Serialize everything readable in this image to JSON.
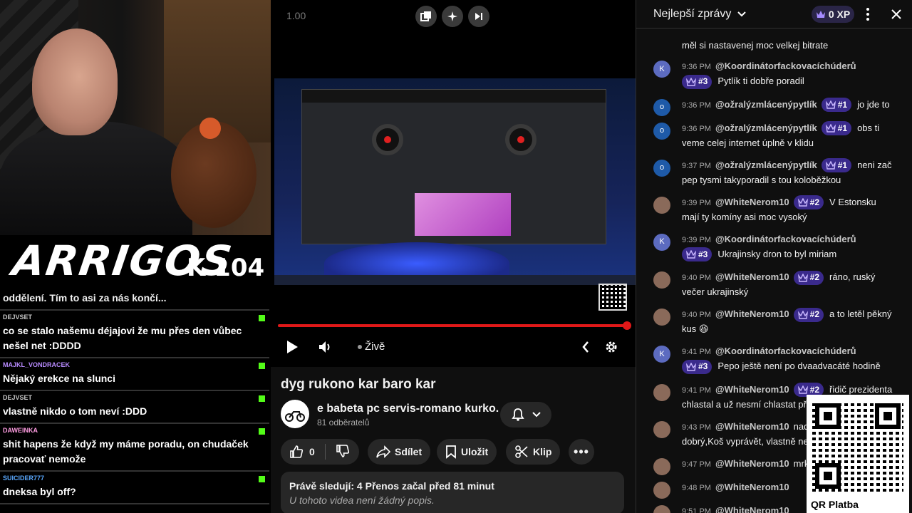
{
  "stream": {
    "logo_main": "ARRIGOS",
    "logo_sub": "K 104",
    "first_line": "oddělení. Tím to asi za nás končí...",
    "messages": [
      {
        "user": "DEJVSET",
        "text": "co se stalo našemu déjajovi že mu přes den vůbec nešel net :DDDD",
        "color": "#c7c7c7"
      },
      {
        "user": "MAJKL_VONDRACEK",
        "text": "Nějaký erekce na slunci",
        "color": "#b88bff"
      },
      {
        "user": "DEJVSET",
        "text": "vlastně nikdo o tom neví :DDD",
        "color": "#c7c7c7"
      },
      {
        "user": "DAWEINKA",
        "text": "shit hapens že když my máme poradu, on chudaček pracovať nemože",
        "color": "#ff9de2"
      },
      {
        "user": "SUICIDER777",
        "text": "dneksa byl off?",
        "color": "#5aa9ff"
      }
    ]
  },
  "player": {
    "speed": "1.00",
    "live_label": "Živě",
    "progress": 1.0
  },
  "video": {
    "title": "dyg rukono kar baro kar",
    "channel_name": "e babeta pc servis-romano kurko.",
    "subscribers": "81 odběratelů",
    "likes": "0",
    "share_label": "Sdílet",
    "save_label": "Uložit",
    "clip_label": "Klip",
    "stats": "Právě sledují: 4  Přenos začal před 81 minut",
    "description": "U tohoto videa není žádný popis."
  },
  "chat": {
    "title": "Nejlepší zprávy",
    "xp": "0 XP",
    "partial_text": "měl si nastavenej moc velkej bitrate",
    "messages": [
      {
        "time": "9:36 PM",
        "author": "@Koordinátorfackovacíchúderů",
        "rank": "#3",
        "text": "Pytlík ti dobře poradil",
        "avatar": "K",
        "avatar_color": "#5c6bc0"
      },
      {
        "time": "9:36 PM",
        "author": "@ožralýzmlácenýpytlík",
        "rank": "#1",
        "text": "jo jde to",
        "avatar": "o",
        "avatar_color": "#1e5aa8"
      },
      {
        "time": "9:36 PM",
        "author": "@ožralýzmlácenýpytlík",
        "rank": "#1",
        "text": "obs ti veme celej internet úplně v klidu",
        "avatar": "o",
        "avatar_color": "#1e5aa8"
      },
      {
        "time": "9:37 PM",
        "author": "@ožralýzmlácenýpytlík",
        "rank": "#1",
        "text": "neni zač pep tysmi takyporadil s tou koloběžkou",
        "avatar": "o",
        "avatar_color": "#1e5aa8"
      },
      {
        "time": "9:39 PM",
        "author": "@WhiteNerom10",
        "rank": "#2",
        "text": "V Estonsku mají ty komíny asi moc vysoký",
        "avatar": "",
        "avatar_color": "#8a6a5a"
      },
      {
        "time": "9:39 PM",
        "author": "@Koordinátorfackovacíchúderů",
        "rank": "#3",
        "text": "Ukrajinsky dron to byl miriam",
        "avatar": "K",
        "avatar_color": "#5c6bc0"
      },
      {
        "time": "9:40 PM",
        "author": "@WhiteNerom10",
        "rank": "#2",
        "text": "ráno, ruský večer ukrajinský",
        "avatar": "",
        "avatar_color": "#8a6a5a"
      },
      {
        "time": "9:40 PM",
        "author": "@WhiteNerom10",
        "rank": "#2",
        "text": "a to letěl pěkný kus 😆",
        "avatar": "",
        "avatar_color": "#8a6a5a"
      },
      {
        "time": "9:41 PM",
        "author": "@Koordinátorfackovacíchúderů",
        "rank": "#3",
        "text": "Pepo ještě není po dvaadvacáté hodině",
        "avatar": "K",
        "avatar_color": "#5c6bc0"
      },
      {
        "time": "9:41 PM",
        "author": "@WhiteNerom10",
        "rank": "#2",
        "text": "řidič prezidenta chlastal a už nesmí chlastat při hotovosti",
        "avatar": "",
        "avatar_color": "#8a6a5a"
      },
      {
        "time": "9:43 PM",
        "author": "@WhiteNerom10",
        "rank": "",
        "text": "nad Moskvou nejsou dobrý,Koš vyprávět, vlastně nemohl už",
        "avatar": "",
        "avatar_color": "#8a6a5a"
      },
      {
        "time": "9:47 PM",
        "author": "@WhiteNerom10",
        "rank": "",
        "text": "mrkvola",
        "avatar": "",
        "avatar_color": "#8a6a5a"
      },
      {
        "time": "9:48 PM",
        "author": "@WhiteNerom10",
        "rank": "",
        "text": "",
        "avatar": "",
        "avatar_color": "#8a6a5a"
      },
      {
        "time": "9:51 PM",
        "author": "@WhiteNerom10",
        "rank": "",
        "text": "",
        "avatar": "",
        "avatar_color": "#8a6a5a"
      }
    ]
  },
  "qr": {
    "label": "QR Platba"
  },
  "icons": {
    "miniplayer": "miniplayer-icon",
    "sparkle": "sparkle-icon",
    "skip": "skip-icon",
    "play": "play-icon",
    "volume": "volume-icon",
    "settings": "gear-icon",
    "chevron": "chevron-left-icon"
  }
}
